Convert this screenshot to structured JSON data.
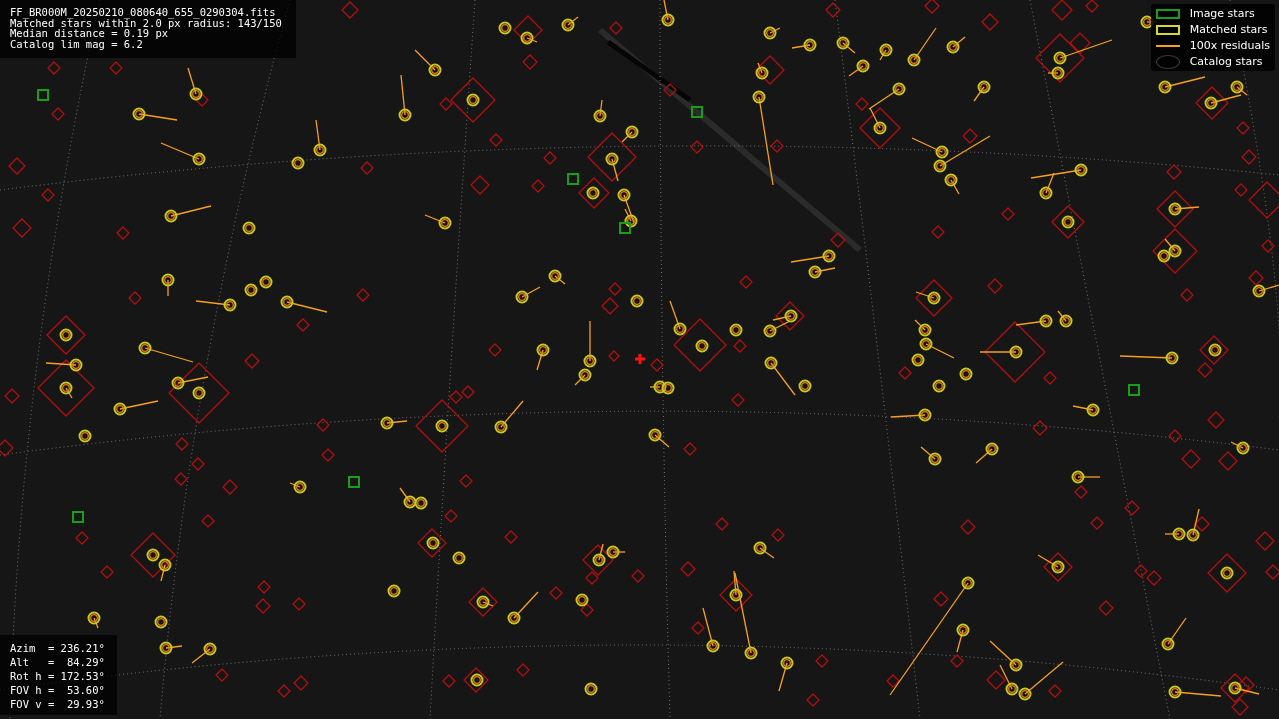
{
  "file_info": {
    "lines": [
      "FF_BR000M_20250210_080640_655_0290304.fits",
      "Matched stars within 2.0 px radius: 143/150",
      "Median distance = 0.19 px",
      "Catalog lim mag = 6.2"
    ]
  },
  "legend": [
    {
      "kind": "image",
      "label": "Image stars"
    },
    {
      "kind": "matched",
      "label": "Matched stars"
    },
    {
      "kind": "residual",
      "label": "100x residuals"
    },
    {
      "kind": "catalog",
      "label": "Catalog stars"
    }
  ],
  "pointing": {
    "lines": [
      "Azim  = 236.21°",
      "Alt   =  84.29°",
      "Rot h = 172.53°",
      "FOV h =  53.60°",
      "FOV v =  29.93°"
    ]
  }
}
